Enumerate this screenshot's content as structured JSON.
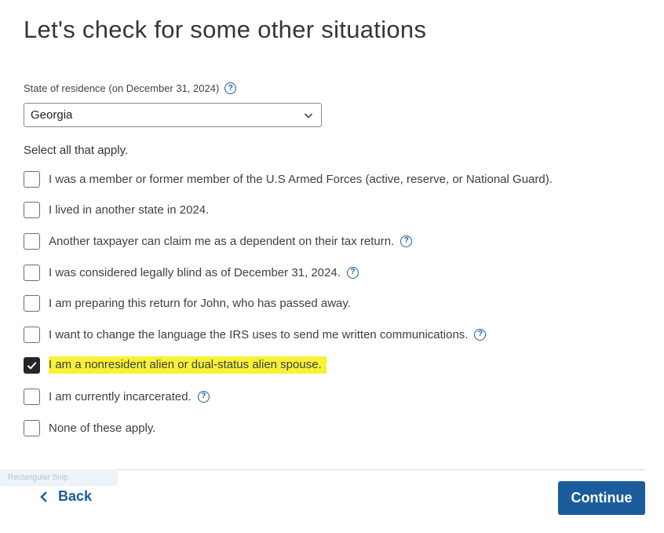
{
  "page": {
    "title": "Let's check for some other situations"
  },
  "state": {
    "label": "State of residence (on December 31, 2024)",
    "selected": "Georgia"
  },
  "instructions": "Select all that apply.",
  "options": [
    {
      "label": "I was a member or former member of the U.S Armed Forces (active, reserve, or National Guard).",
      "checked": false,
      "help": false
    },
    {
      "label": "I lived in another state in 2024.",
      "checked": false,
      "help": false
    },
    {
      "label": "Another taxpayer can claim me as a dependent on their tax return.",
      "checked": false,
      "help": true
    },
    {
      "label": "I was considered legally blind as of December 31, 2024.",
      "checked": false,
      "help": true
    },
    {
      "label": "I am preparing this return for John, who has passed away.",
      "checked": false,
      "help": false
    },
    {
      "label": "I want to change the language the IRS uses to send me written communications.",
      "checked": false,
      "help": true
    },
    {
      "label": "I am a nonresident alien or dual-status alien spouse.",
      "checked": true,
      "help": false,
      "highlight": "#f7f236"
    },
    {
      "label": "I am currently incarcerated.",
      "checked": false,
      "help": true
    },
    {
      "label": "None of these apply.",
      "checked": false,
      "help": false
    }
  ],
  "snip_overlay": "Rectangular Snip",
  "footer": {
    "back_label": "Back",
    "continue_label": "Continue"
  },
  "colors": {
    "accent": "#1b5c9c",
    "highlight": "#f7f236",
    "checkbox_checked": "#23262a"
  },
  "icons": {
    "help": "?",
    "dropdown": "chevron-down",
    "back": "chevron-left",
    "check": "checkmark"
  }
}
